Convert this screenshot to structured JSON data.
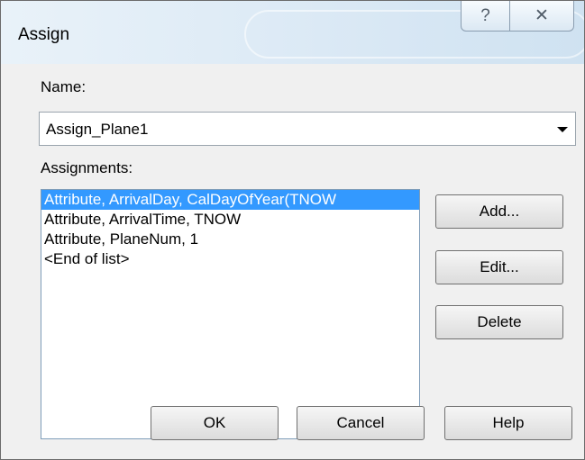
{
  "window": {
    "title": "Assign",
    "help_glyph": "?",
    "close_glyph": "✕"
  },
  "name_section": {
    "label": "Name:",
    "value": "Assign_Plane1"
  },
  "assignments_section": {
    "label": "Assignments:",
    "items": [
      "Attribute, ArrivalDay, CalDayOfYear(TNOW",
      "Attribute, ArrivalTime, TNOW",
      "Attribute, PlaneNum, 1",
      "<End of list>"
    ],
    "selected_index": 0
  },
  "side_buttons": {
    "add": "Add...",
    "edit": "Edit...",
    "delete": "Delete"
  },
  "footer_buttons": {
    "ok": "OK",
    "cancel": "Cancel",
    "help": "Help"
  },
  "colors": {
    "selection": "#3399ff",
    "titlebar": "#dbe9f5",
    "dialog_background": "#f0f0f0"
  }
}
